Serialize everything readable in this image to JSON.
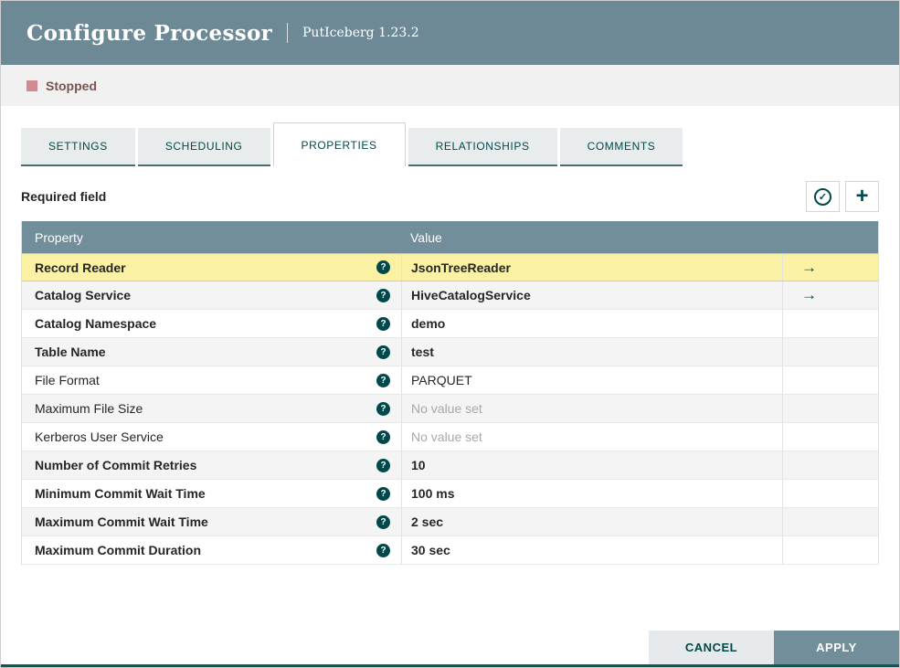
{
  "header": {
    "title": "Configure Processor",
    "subtitle": "PutIceberg 1.23.2"
  },
  "status": {
    "label": "Stopped"
  },
  "tabs": [
    {
      "label": "SETTINGS",
      "active": false
    },
    {
      "label": "SCHEDULING",
      "active": false
    },
    {
      "label": "PROPERTIES",
      "active": true
    },
    {
      "label": "RELATIONSHIPS",
      "active": false
    },
    {
      "label": "COMMENTS",
      "active": false
    }
  ],
  "toolbar": {
    "required_field_label": "Required field"
  },
  "icons": {
    "verify": "✓",
    "add": "+",
    "help": "?",
    "goto": "→"
  },
  "table": {
    "columns": [
      "Property",
      "Value"
    ],
    "rows": [
      {
        "property": "Record Reader",
        "value": "JsonTreeReader",
        "bold": true,
        "selected": true,
        "has_goto": true,
        "no_value": false
      },
      {
        "property": "Catalog Service",
        "value": "HiveCatalogService",
        "bold": true,
        "selected": false,
        "has_goto": true,
        "no_value": false
      },
      {
        "property": "Catalog Namespace",
        "value": "demo",
        "bold": true,
        "selected": false,
        "has_goto": false,
        "no_value": false
      },
      {
        "property": "Table Name",
        "value": "test",
        "bold": true,
        "selected": false,
        "has_goto": false,
        "no_value": false
      },
      {
        "property": "File Format",
        "value": "PARQUET",
        "bold": false,
        "selected": false,
        "has_goto": false,
        "no_value": false
      },
      {
        "property": "Maximum File Size",
        "value": "No value set",
        "bold": false,
        "selected": false,
        "has_goto": false,
        "no_value": true
      },
      {
        "property": "Kerberos User Service",
        "value": "No value set",
        "bold": false,
        "selected": false,
        "has_goto": false,
        "no_value": true
      },
      {
        "property": "Number of Commit Retries",
        "value": "10",
        "bold": true,
        "selected": false,
        "has_goto": false,
        "no_value": false
      },
      {
        "property": "Minimum Commit Wait Time",
        "value": "100 ms",
        "bold": true,
        "selected": false,
        "has_goto": false,
        "no_value": false
      },
      {
        "property": "Maximum Commit Wait Time",
        "value": "2 sec",
        "bold": true,
        "selected": false,
        "has_goto": false,
        "no_value": false
      },
      {
        "property": "Maximum Commit Duration",
        "value": "30 sec",
        "bold": true,
        "selected": false,
        "has_goto": false,
        "no_value": false
      }
    ]
  },
  "footer": {
    "cancel_label": "CANCEL",
    "apply_label": "APPLY"
  },
  "colors": {
    "accent_teal": "#004849",
    "header_bg": "#6d8996",
    "table_header_bg": "#728e9b",
    "selected_row_bg": "#fbf1a4",
    "stopped_square": "#d18b8f",
    "stopped_text": "#775351"
  }
}
